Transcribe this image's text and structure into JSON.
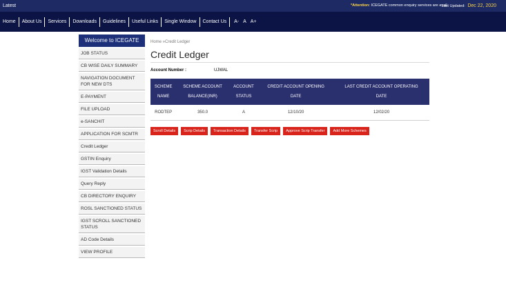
{
  "topbar": {
    "latest": "Latest",
    "attention_label": "*Attention:",
    "attention_text": "ICEGATE common enquiry services are avail",
    "last_updated_label": "Last Updated:",
    "last_updated_date": "Dec 22, 2020"
  },
  "nav": {
    "items": [
      "Home",
      "About Us",
      "Services",
      "Downloads",
      "Guidelines",
      "Useful Links",
      "Single Window",
      "Contact Us"
    ],
    "font_sizes": [
      "A-",
      "A",
      "A+"
    ]
  },
  "sidebar": {
    "welcome": "Welcome to ICEGATE",
    "items": [
      "JOB STATUS",
      "CB WISE DAILY SUMMARY",
      "NAVIGATION DOCUMENT FOR NEW DTS",
      "E-PAYMENT",
      "FILE UPLOAD",
      "e-SANCHIT",
      "APPLICATION FOR SCMTR",
      "Credit Ledger",
      "GSTIN Enquiry",
      "IGST Validation Details",
      "Query Reply",
      "CB DIRECTORY ENQUIRY",
      "ROSL SANCTIONED STATUS",
      "IGST SCROLL SANCTIONED STATUS",
      "AD Code Details",
      "VIEW PROFILE"
    ]
  },
  "main": {
    "breadcrumb": "Home »Credit Ledger",
    "title": "Credit Ledger",
    "account_label": "Account Number :",
    "account_value": "UJWAL",
    "table": {
      "headers": [
        [
          "SCHEME",
          "NAME"
        ],
        [
          "SCHEME ACCOUNT",
          "BALANCE(INR)"
        ],
        [
          "ACCOUNT",
          "STATUS"
        ],
        [
          "CREDIT ACCOUNT OPENING",
          "DATE"
        ],
        [
          "LAST CREDIT ACCOUNT OPERATING",
          "DATE"
        ]
      ],
      "rows": [
        [
          "RODTEP",
          "350.0",
          "A",
          "12/10/20",
          "12/02/20"
        ]
      ]
    },
    "buttons": [
      "Scroll Details",
      "Scrip Details",
      "Transaction Details",
      "Transfer Scrip",
      "Approve Scrip Transfer",
      "Add More Schemes"
    ]
  }
}
